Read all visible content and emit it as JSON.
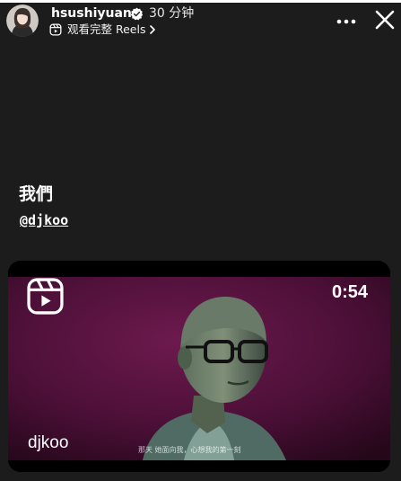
{
  "story": {
    "progress": 1.0
  },
  "header": {
    "username": "hsushiyuan",
    "verified": true,
    "time_ago": "30 分钟",
    "reels_link_label": "观看完整 Reels",
    "icons": {
      "verified": "verified-badge-icon",
      "reels": "reels-icon",
      "chevron": "chevron-right-icon",
      "more": "more-options-icon",
      "close": "close-icon"
    }
  },
  "caption": {
    "text": "我們",
    "mention": "@djkoo"
  },
  "reel_card": {
    "duration": "0:54",
    "author": "djkoo",
    "subtitle": "那天 她面向我，心想我的第一刻",
    "icon": "reels-logo-icon"
  },
  "colors": {
    "background": "#1c1c1c",
    "text": "#ffffff",
    "verified_badge": "#ffffff",
    "video_tint": "#5e1040"
  }
}
